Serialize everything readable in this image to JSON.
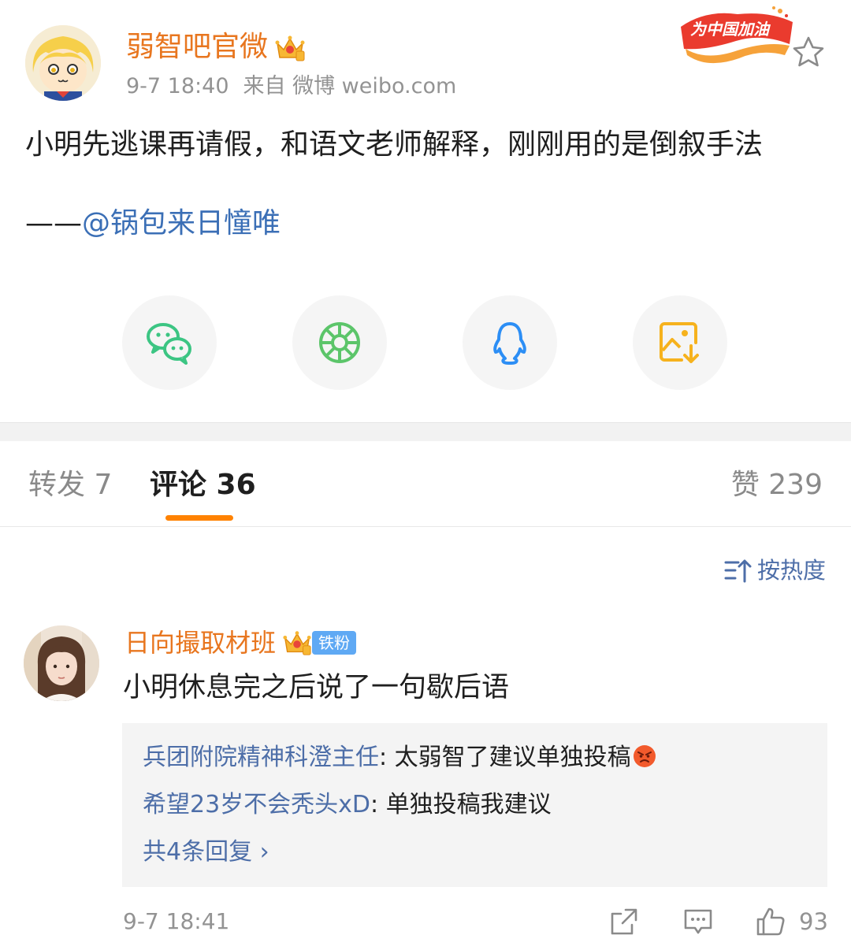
{
  "post": {
    "author": "弱智吧官微",
    "time": "9-7 18:40",
    "source": "来自 微博 weibo.com",
    "promo_badge": "为中国加油",
    "text": "小明先逃课再请假，和语文老师解释，刚刚用的是倒叙手法",
    "signature_dash": "——",
    "signature_mention": "@锅包来日憧唯"
  },
  "share": {
    "icons": [
      "wechat-icon",
      "moments-icon",
      "qq-icon",
      "save-image-icon"
    ],
    "colors": {
      "wechat": "#3cc583",
      "moments": "#5cc56a",
      "qq": "#2c8ef5",
      "save": "#f6b21d"
    }
  },
  "tabs": {
    "repost": "转发 7",
    "comment": "评论 36",
    "like": "赞 239"
  },
  "sort": {
    "label": "按热度"
  },
  "comment": {
    "author": "日向撮取材班",
    "fan_badge": "铁粉",
    "text": "小明休息完之后说了一句歇后语",
    "replies": [
      {
        "name": "兵团附院精神科澄主任",
        "text": ": 太弱智了建议单独投稿"
      },
      {
        "name": "希望23岁不会秃头xD",
        "text": ": 单独投稿我建议"
      }
    ],
    "more_replies": "共4条回复 ›",
    "time": "9-7 18:41",
    "likes": "93"
  },
  "colors": {
    "accent": "#ff8200",
    "username": "#e8761f",
    "link": "#4d6ea8"
  }
}
